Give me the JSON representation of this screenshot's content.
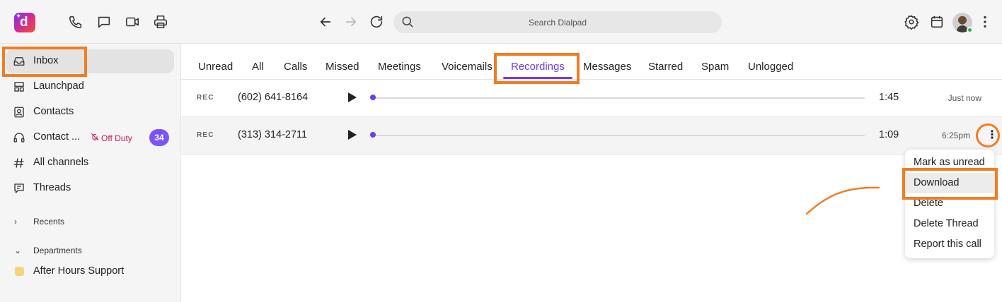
{
  "app": {
    "name": "Dialpad",
    "logo_letter": "d"
  },
  "topbar": {
    "search_placeholder": "Search Dialpad",
    "icons": [
      "phone-icon",
      "chat-icon",
      "video-icon",
      "printer-icon",
      "back-arrow-icon",
      "forward-arrow-icon",
      "refresh-icon",
      "search-icon",
      "gear-icon",
      "calendar-icon",
      "avatar",
      "more-vertical-icon"
    ]
  },
  "sidebar": {
    "items": [
      {
        "label": "Inbox",
        "icon": "inbox-icon"
      },
      {
        "label": "Launchpad",
        "icon": "launchpad-icon"
      },
      {
        "label": "Contacts",
        "icon": "contacts-icon"
      },
      {
        "label": "Contact ...",
        "icon": "headset-icon",
        "status": "Off Duty",
        "badge": "34"
      },
      {
        "label": "All channels",
        "icon": "hash-icon"
      },
      {
        "label": "Threads",
        "icon": "threads-icon"
      }
    ],
    "recents_label": "Recents",
    "departments_label": "Departments",
    "department": "After Hours Support"
  },
  "tabs": [
    {
      "label": "Unread"
    },
    {
      "label": "All"
    },
    {
      "label": "Calls"
    },
    {
      "label": "Missed"
    },
    {
      "label": "Meetings"
    },
    {
      "label": "Voicemails"
    },
    {
      "label": "Recordings",
      "active": true
    },
    {
      "label": "Messages"
    },
    {
      "label": "Starred"
    },
    {
      "label": "Spam"
    },
    {
      "label": "Unlogged"
    }
  ],
  "recordings": [
    {
      "tag": "REC",
      "phone": "(602) 641-8164",
      "duration": "1:45",
      "time": "Just now",
      "progress": 0
    },
    {
      "tag": "REC",
      "phone": "(313) 314-2711",
      "duration": "1:09",
      "time": "6:25pm",
      "progress": 0
    }
  ],
  "context_menu": {
    "items": [
      "Mark as unread",
      "Download",
      "Delete",
      "Delete Thread",
      "Report this call"
    ],
    "hovered": "Download"
  },
  "colors": {
    "accent": "#6a3df5",
    "annotation": "#f07d24",
    "badge": "#7c52ff",
    "off_duty": "#c2185b"
  }
}
